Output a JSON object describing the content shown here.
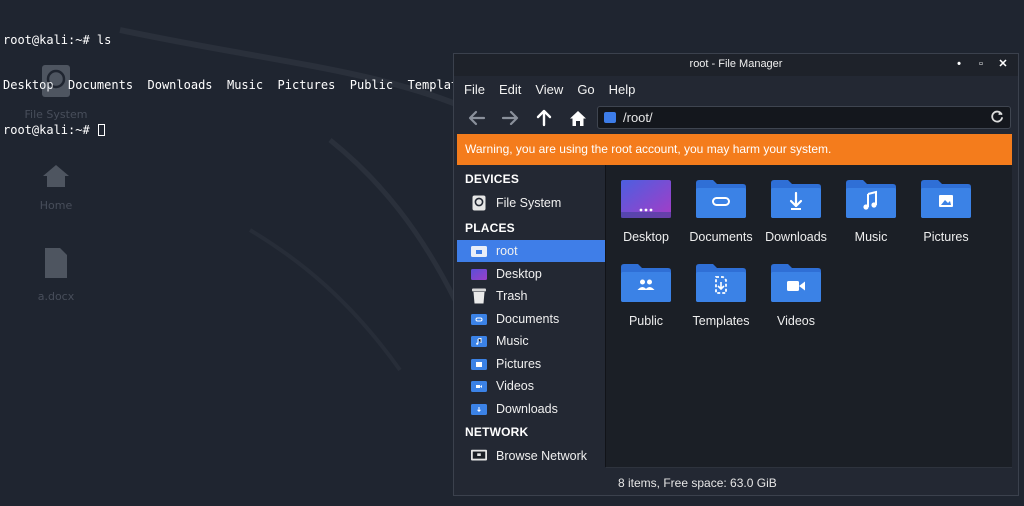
{
  "terminal": {
    "line1": "root@kali:~# ls",
    "line2": "Desktop  Documents  Downloads  Music  Pictures  Public  Templates  Videos",
    "line3": "root@kali:~# "
  },
  "desktop_icons": [
    {
      "label": "File System",
      "icon": "drive-icon"
    },
    {
      "label": "Home",
      "icon": "home-icon"
    },
    {
      "label": "a.docx",
      "icon": "document-icon"
    }
  ],
  "window": {
    "title": "root - File Manager",
    "controls": {
      "minimize": "•",
      "maximize": "▫",
      "close": "✕"
    }
  },
  "menubar": [
    "File",
    "Edit",
    "View",
    "Go",
    "Help"
  ],
  "toolbar": {
    "back_icon": "arrow-left-icon",
    "forward_icon": "arrow-right-icon",
    "up_icon": "arrow-up-icon",
    "home_icon": "home-icon",
    "path": "/root/",
    "reload_icon": "reload-icon"
  },
  "warning": "Warning, you are using the root account, you may harm your system.",
  "sidebar": {
    "devices_header": "DEVICES",
    "devices": [
      {
        "label": "File System",
        "icon": "drive-icon"
      }
    ],
    "places_header": "PLACES",
    "places": [
      {
        "label": "root",
        "icon": "home-folder-icon",
        "selected": true
      },
      {
        "label": "Desktop",
        "icon": "desktop-icon",
        "selected": false
      },
      {
        "label": "Trash",
        "icon": "trash-icon",
        "selected": false
      },
      {
        "label": "Documents",
        "icon": "documents-folder-icon",
        "selected": false
      },
      {
        "label": "Music",
        "icon": "music-folder-icon",
        "selected": false
      },
      {
        "label": "Pictures",
        "icon": "pictures-folder-icon",
        "selected": false
      },
      {
        "label": "Videos",
        "icon": "videos-folder-icon",
        "selected": false
      },
      {
        "label": "Downloads",
        "icon": "downloads-folder-icon",
        "selected": false
      }
    ],
    "network_header": "NETWORK",
    "network": [
      {
        "label": "Browse Network",
        "icon": "network-icon"
      }
    ]
  },
  "files": [
    {
      "label": "Desktop",
      "icon": "desktop-folder-icon"
    },
    {
      "label": "Documents",
      "icon": "documents-folder-icon"
    },
    {
      "label": "Downloads",
      "icon": "downloads-folder-icon"
    },
    {
      "label": "Music",
      "icon": "music-folder-icon"
    },
    {
      "label": "Pictures",
      "icon": "pictures-folder-icon"
    },
    {
      "label": "Public",
      "icon": "public-folder-icon"
    },
    {
      "label": "Templates",
      "icon": "templates-folder-icon"
    },
    {
      "label": "Videos",
      "icon": "videos-folder-icon"
    }
  ],
  "status": "8 items, Free space: 63.0 GiB",
  "colors": {
    "accent": "#3f7ee8",
    "folder": "#3b82e6",
    "folder_tab": "#2f6fd6",
    "warning_bg": "#f47c1c"
  }
}
